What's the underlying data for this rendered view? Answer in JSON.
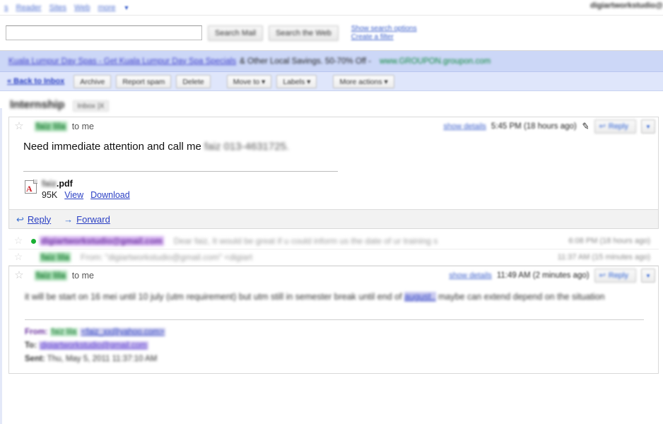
{
  "topnav": {
    "items": [
      {
        "label": "s",
        "name": "topnav-item-s"
      },
      {
        "label": "Reader",
        "name": "topnav-item-reader"
      },
      {
        "label": "Sites",
        "name": "topnav-item-sites"
      },
      {
        "label": "Web",
        "name": "topnav-item-web"
      },
      {
        "label": "more",
        "name": "topnav-item-more"
      }
    ],
    "more_caret": "▼",
    "account_email": "digiartworkstudio@"
  },
  "search": {
    "query": "",
    "placeholder": "",
    "search_mail_label": "Search Mail",
    "search_web_label": "Search the Web",
    "show_options_label": "Show search options",
    "create_filter_label": "Create a filter"
  },
  "ad": {
    "title": "Kuala Lumpur Day Spas - Get Kuala Lumpur Day Spa Specials",
    "text": "& Other Local Savings. 50-70% Off -",
    "url": "www.GROUPON.groupon.com"
  },
  "toolbar": {
    "back_label": "« Back to Inbox",
    "buttons": [
      {
        "label": "Archive",
        "name": "archive-button"
      },
      {
        "label": "Report spam",
        "name": "report-spam-button"
      },
      {
        "label": "Delete",
        "name": "delete-button"
      }
    ],
    "dropdowns": [
      {
        "label": "Move to ▾",
        "name": "move-to-dropdown"
      },
      {
        "label": "Labels ▾",
        "name": "labels-dropdown"
      },
      {
        "label": "More actions ▾",
        "name": "more-actions-dropdown"
      }
    ]
  },
  "thread": {
    "subject": "Internship",
    "label": "Inbox  |X"
  },
  "message1": {
    "star": "☆",
    "sender": "faiz lila",
    "to": "to me",
    "show_details": "show details",
    "timestamp": "5:45 PM (18 hours ago)",
    "pencil": "✎",
    "reply_label": "Reply",
    "reply_icon": "↩",
    "caret": "▾",
    "body_text": "Need immediate attention and call me ",
    "body_redacted": "faiz 013-4631725.",
    "attachment": {
      "name_redacted": "faiz",
      "name_ext": ".pdf",
      "size": "95K",
      "view_label": "View",
      "download_label": "Download"
    },
    "footer": {
      "reply_label": "Reply",
      "reply_icon": "↩",
      "forward_label": "Forward",
      "forward_icon": "→"
    }
  },
  "collapsed_rows": [
    {
      "name": "collapsed-message-1",
      "star": "☆",
      "sender": "digiartworkstudio@gmail.com",
      "sender_color": "purple",
      "unread_dot": true,
      "snippet": "Dear faiz,    It would be great if u could inform us the date of ur training s",
      "time": "6:08 PM (18 hours ago)"
    },
    {
      "name": "collapsed-message-2",
      "star": "☆",
      "sender": "faiz lila",
      "sender_color": "green",
      "unread_dot": false,
      "snippet": "From: \"digiartworkstudio@gmail.com\" <digiart",
      "time": "11:37 AM (15 minutes ago)"
    }
  ],
  "message2": {
    "star": "☆",
    "sender": "faiz lila",
    "to": "to me",
    "show_details": "show details",
    "timestamp": "11:49 AM (2 minutes ago)",
    "reply_label": "Reply",
    "reply_icon": "↩",
    "caret": "▾",
    "body_part1": "it will be start on 16 mei until 10 july (utm requirement) but utm still in semester break until end of ",
    "body_link": "august..",
    "body_part2": " maybe can extend depend on the situation",
    "quote": {
      "from_key": "From:",
      "from_name": "faiz lila",
      "from_mail": "<faiz_xx@yahoo.com>",
      "to_key": "To:",
      "to_mail": "digiartworkstudio@gmail.com",
      "sent_key": "Sent:",
      "sent_value": "Thu, May 5, 2011 11:37:10 AM"
    }
  }
}
